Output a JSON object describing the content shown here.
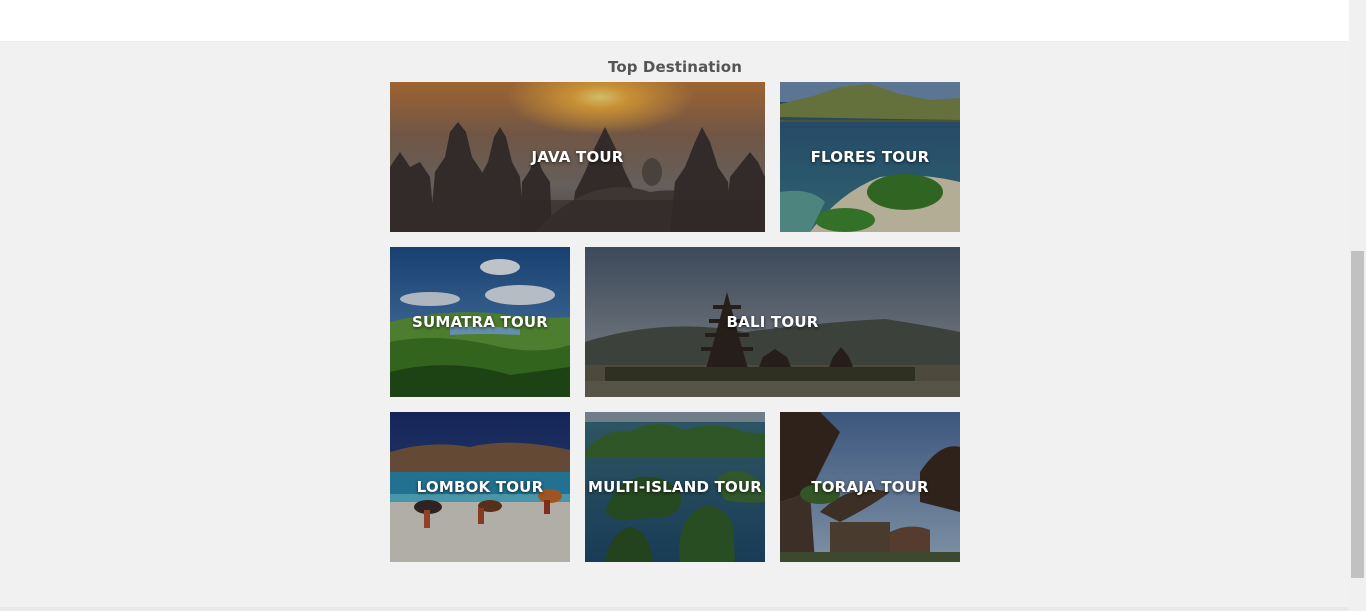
{
  "section": {
    "title": "Top Destination"
  },
  "tiles": [
    {
      "label": "JAVA TOUR"
    },
    {
      "label": "FLORES TOUR"
    },
    {
      "label": "SUMATRA TOUR"
    },
    {
      "label": "BALI TOUR"
    },
    {
      "label": "LOMBOK TOUR"
    },
    {
      "label": "MULTI-ISLAND TOUR"
    },
    {
      "label": "TORAJA TOUR"
    }
  ],
  "colors": {
    "page_background": "#f1f1f1",
    "header_background": "#ffffff",
    "title_text": "#555555",
    "tile_label_text": "#ffffff",
    "scrollbar_thumb": "#c1c1c1"
  }
}
